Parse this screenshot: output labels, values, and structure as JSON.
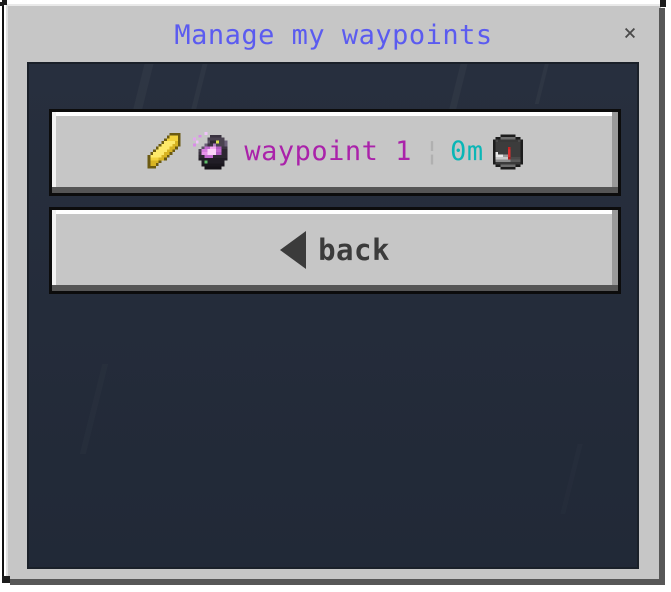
{
  "window": {
    "title": "Manage my waypoints",
    "close_label": "×",
    "frame_color": "#c6c6c6",
    "panel_color": "#232b3a",
    "title_color": "#5b5bf0"
  },
  "waypoint_row": {
    "edit_icon": "pencil-icon",
    "item_icon": "enchanted-beacon-icon",
    "name": "waypoint 1",
    "name_color": "#aa22aa",
    "separator": "¦",
    "distance": "0m",
    "distance_color": "#0ab6b6",
    "compass_icon": "compass-icon"
  },
  "back_button": {
    "arrow_icon": "left-triangle-icon",
    "label": "back",
    "label_color": "#3b3b3b"
  }
}
